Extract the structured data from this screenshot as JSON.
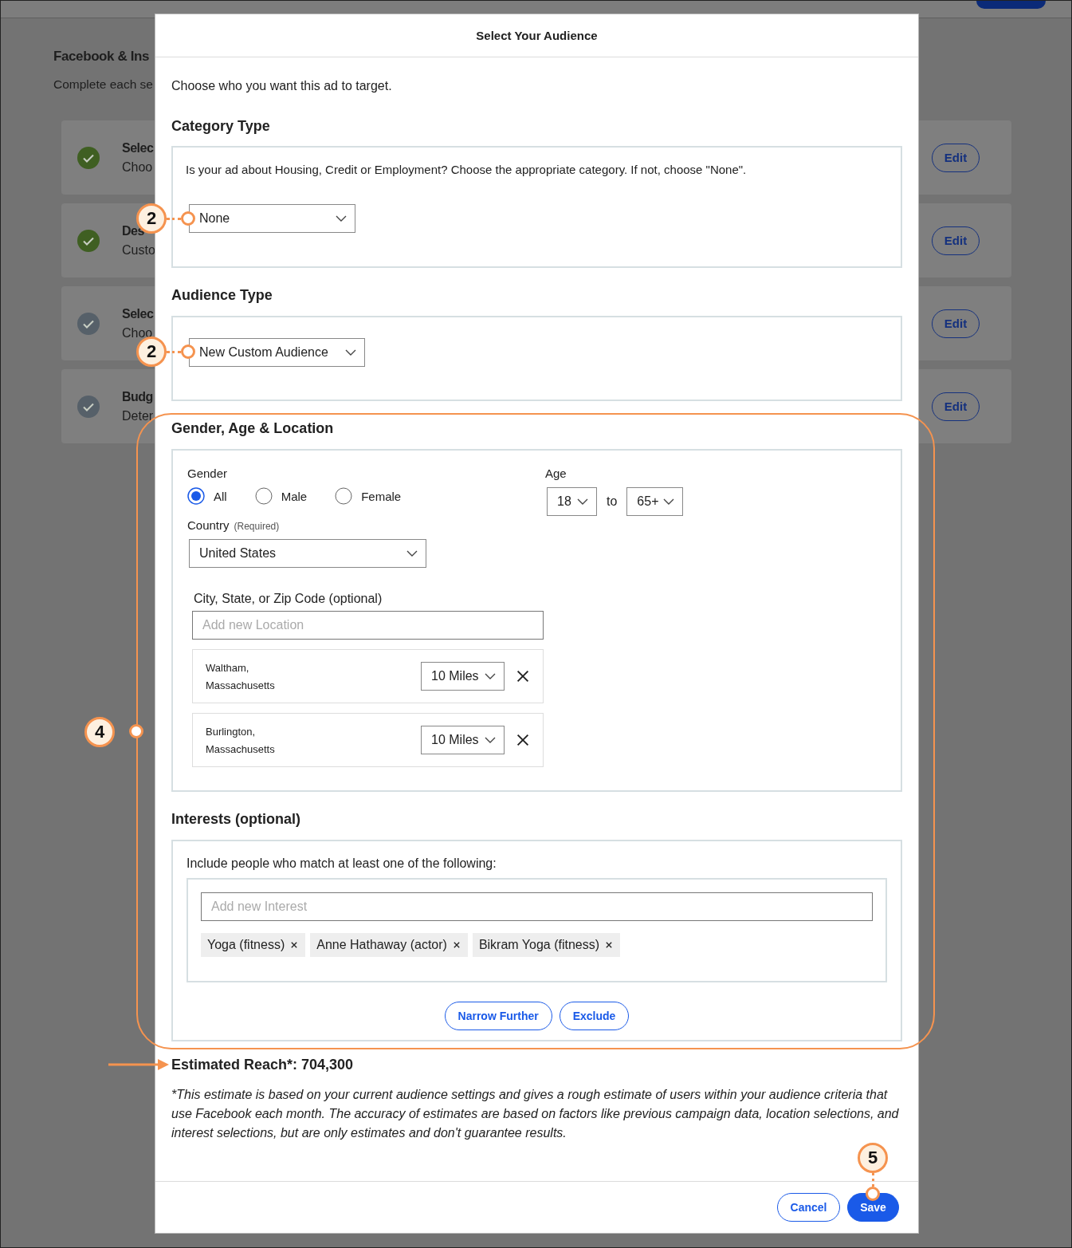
{
  "background": {
    "title": "Facebook & Ins",
    "subtitle": "Complete each se",
    "steps": [
      {
        "title": "Selec",
        "description": "Choo",
        "completed": true,
        "action": "Edit"
      },
      {
        "title": "Des",
        "description": "Custo",
        "completed": true,
        "action": "Edit"
      },
      {
        "title": "Selec",
        "description": "Choo",
        "completed": false,
        "action": "Edit"
      },
      {
        "title": "Budg",
        "description": "Deter",
        "completed": false,
        "action": "Edit"
      }
    ]
  },
  "dialog": {
    "title": "Select Your Audience",
    "intro": "Choose who you want this ad to target.",
    "category_type": {
      "heading": "Category Type",
      "question": "Is your ad about Housing, Credit or Employment? Choose the appropriate category. If not, choose \"None\".",
      "value": "None"
    },
    "audience_type": {
      "heading": "Audience Type",
      "value": "New Custom Audience"
    },
    "gender_age_location": {
      "heading": "Gender, Age & Location",
      "gender": {
        "label": "Gender",
        "options": [
          {
            "label": "All",
            "selected": true
          },
          {
            "label": "Male",
            "selected": false
          },
          {
            "label": "Female",
            "selected": false
          }
        ]
      },
      "age": {
        "label": "Age",
        "min": "18",
        "separator": "to",
        "max": "65+"
      },
      "country": {
        "label": "Country",
        "hint": "(Required)",
        "value": "United States"
      },
      "location": {
        "label": "City, State, or Zip Code (optional)",
        "placeholder": "Add new Location",
        "items": [
          {
            "city": "Waltham,",
            "state": "Massachusetts",
            "radius": "10 Miles"
          },
          {
            "city": "Burlington,",
            "state": "Massachusetts",
            "radius": "10 Miles"
          }
        ]
      }
    },
    "interests": {
      "heading": "Interests (optional)",
      "prompt": "Include people who match at least one of the following:",
      "placeholder": "Add new Interest",
      "tags": [
        "Yoga (fitness)",
        "Anne Hathaway (actor)",
        "Bikram Yoga (fitness)"
      ],
      "buttons": [
        "Narrow Further",
        "Exclude"
      ]
    },
    "estimated_reach": "Estimated Reach*: 704,300",
    "disclaimer": "*This estimate is based on your current audience settings and gives a rough estimate of users within your audience criteria that use Facebook each month. The accuracy of estimates are based on factors like previous campaign data, location selections, and interest selections, but are only estimates and don't guarantee results.",
    "buttons": [
      {
        "label": "Cancel",
        "kind": "secondary"
      },
      {
        "label": "Save",
        "kind": "primary"
      }
    ]
  },
  "callouts": [
    {
      "number": "2"
    },
    {
      "number": "2"
    },
    {
      "number": "4"
    },
    {
      "number": "5"
    }
  ]
}
